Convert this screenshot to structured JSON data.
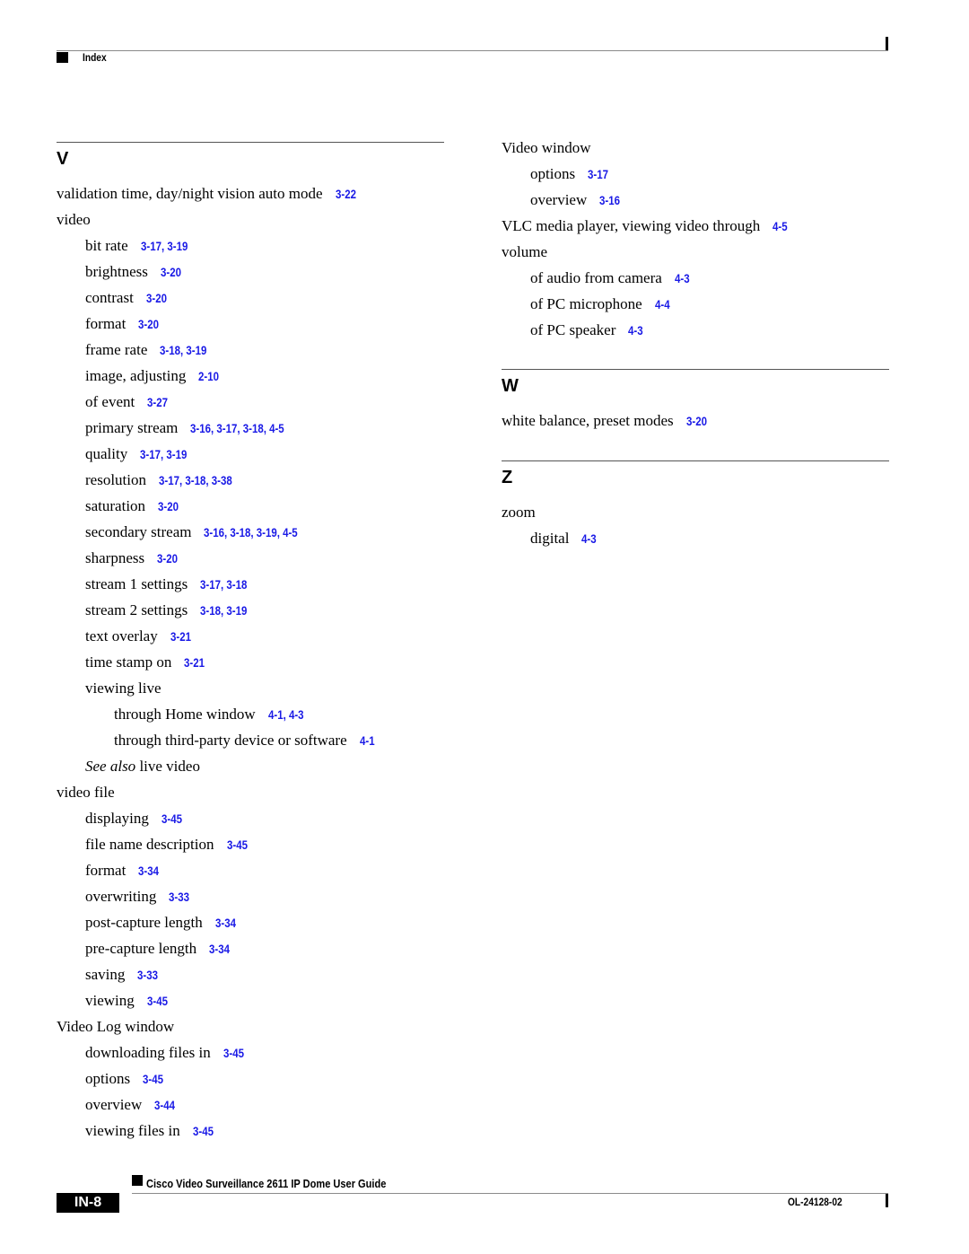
{
  "header": {
    "section_label": "Index"
  },
  "columns": [
    {
      "sections": [
        {
          "letter": "V",
          "entries": [
            {
              "level": 1,
              "term": "validation time, day/night vision auto mode",
              "refs": [
                "3-22"
              ]
            },
            {
              "level": 1,
              "term": "video",
              "refs": []
            },
            {
              "level": 2,
              "term": "bit rate",
              "refs": [
                "3-17",
                "3-19"
              ]
            },
            {
              "level": 2,
              "term": "brightness",
              "refs": [
                "3-20"
              ]
            },
            {
              "level": 2,
              "term": "contrast",
              "refs": [
                "3-20"
              ]
            },
            {
              "level": 2,
              "term": "format",
              "refs": [
                "3-20"
              ]
            },
            {
              "level": 2,
              "term": "frame rate",
              "refs": [
                "3-18",
                "3-19"
              ]
            },
            {
              "level": 2,
              "term": "image, adjusting",
              "refs": [
                "2-10"
              ]
            },
            {
              "level": 2,
              "term": "of event",
              "refs": [
                "3-27"
              ]
            },
            {
              "level": 2,
              "term": "primary stream",
              "refs": [
                "3-16",
                "3-17",
                "3-18",
                "4-5"
              ]
            },
            {
              "level": 2,
              "term": "quality",
              "refs": [
                "3-17",
                "3-19"
              ]
            },
            {
              "level": 2,
              "term": "resolution",
              "refs": [
                "3-17",
                "3-18",
                "3-38"
              ]
            },
            {
              "level": 2,
              "term": "saturation",
              "refs": [
                "3-20"
              ]
            },
            {
              "level": 2,
              "term": "secondary stream",
              "refs": [
                "3-16",
                "3-18",
                "3-19",
                "4-5"
              ]
            },
            {
              "level": 2,
              "term": "sharpness",
              "refs": [
                "3-20"
              ]
            },
            {
              "level": 2,
              "term": "stream 1 settings",
              "refs": [
                "3-17",
                "3-18"
              ]
            },
            {
              "level": 2,
              "term": "stream 2 settings",
              "refs": [
                "3-18",
                "3-19"
              ]
            },
            {
              "level": 2,
              "term": "text overlay",
              "refs": [
                "3-21"
              ]
            },
            {
              "level": 2,
              "term": "time stamp on",
              "refs": [
                "3-21"
              ]
            },
            {
              "level": 2,
              "term": "viewing live",
              "refs": []
            },
            {
              "level": 3,
              "term": "through Home window",
              "refs": [
                "4-1",
                "4-3"
              ]
            },
            {
              "level": 3,
              "term": "through third-party device or software",
              "refs": [
                "4-1"
              ]
            },
            {
              "level": 2,
              "see_also_prefix": "See also",
              "term": "live video",
              "refs": []
            },
            {
              "level": 1,
              "term": "video file",
              "refs": []
            },
            {
              "level": 2,
              "term": "displaying",
              "refs": [
                "3-45"
              ]
            },
            {
              "level": 2,
              "term": "file name description",
              "refs": [
                "3-45"
              ]
            },
            {
              "level": 2,
              "term": "format",
              "refs": [
                "3-34"
              ]
            },
            {
              "level": 2,
              "term": "overwriting",
              "refs": [
                "3-33"
              ]
            },
            {
              "level": 2,
              "term": "post-capture length",
              "refs": [
                "3-34"
              ]
            },
            {
              "level": 2,
              "term": "pre-capture length",
              "refs": [
                "3-34"
              ]
            },
            {
              "level": 2,
              "term": "saving",
              "refs": [
                "3-33"
              ]
            },
            {
              "level": 2,
              "term": "viewing",
              "refs": [
                "3-45"
              ]
            },
            {
              "level": 1,
              "term": "Video Log window",
              "refs": []
            },
            {
              "level": 2,
              "term": "downloading files in",
              "refs": [
                "3-45"
              ]
            },
            {
              "level": 2,
              "term": "options",
              "refs": [
                "3-45"
              ]
            },
            {
              "level": 2,
              "term": "overview",
              "refs": [
                "3-44"
              ]
            },
            {
              "level": 2,
              "term": "viewing files in",
              "refs": [
                "3-45"
              ]
            }
          ]
        }
      ]
    },
    {
      "sections": [
        {
          "letter": "",
          "entries": [
            {
              "level": 1,
              "term": "Video window",
              "refs": []
            },
            {
              "level": 2,
              "term": "options",
              "refs": [
                "3-17"
              ]
            },
            {
              "level": 2,
              "term": "overview",
              "refs": [
                "3-16"
              ]
            },
            {
              "level": 1,
              "term": "VLC media player, viewing video through",
              "refs": [
                "4-5"
              ]
            },
            {
              "level": 1,
              "term": "volume",
              "refs": []
            },
            {
              "level": 2,
              "term": "of audio from camera",
              "refs": [
                "4-3"
              ]
            },
            {
              "level": 2,
              "term": "of PC microphone",
              "refs": [
                "4-4"
              ]
            },
            {
              "level": 2,
              "term": "of PC speaker",
              "refs": [
                "4-3"
              ]
            }
          ]
        },
        {
          "letter": "W",
          "entries": [
            {
              "level": 1,
              "term": "white balance, preset modes",
              "refs": [
                "3-20"
              ]
            }
          ]
        },
        {
          "letter": "Z",
          "entries": [
            {
              "level": 1,
              "term": "zoom",
              "refs": []
            },
            {
              "level": 2,
              "term": "digital",
              "refs": [
                "4-3"
              ]
            }
          ]
        }
      ]
    }
  ],
  "footer": {
    "guide_title": "Cisco Video Surveillance 2611 IP Dome User Guide",
    "page_number": "IN-8",
    "doc_number": "OL-24128-02"
  },
  "colors": {
    "link": "#1a1ae6",
    "text": "#000000"
  }
}
